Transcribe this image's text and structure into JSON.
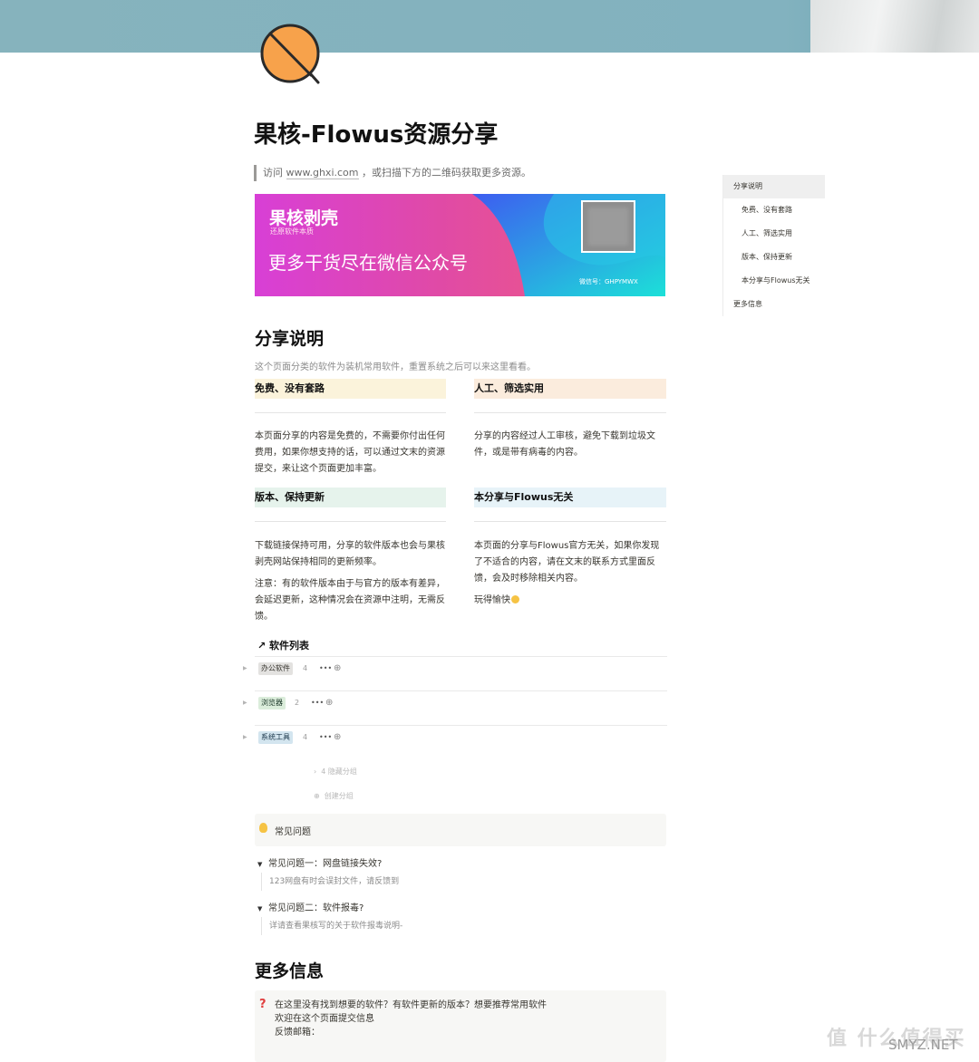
{
  "page": {
    "title": "果核-Flowus资源分享",
    "quote": {
      "prefix": "访问 ",
      "link": "www.ghxi.com",
      "suffix": " ，或扫描下方的二维码获取更多资源。"
    }
  },
  "banner": {
    "title": "果核剥壳",
    "subtitle": "还原软件本质",
    "slogan": "更多干货尽在微信公众号",
    "wechat_id": "微信号：GHPYMWX"
  },
  "toc": {
    "items": [
      {
        "label": "分享说明",
        "active": true
      },
      {
        "label": "免费、没有套路"
      },
      {
        "label": "人工、筛选实用"
      },
      {
        "label": "版本、保持更新"
      },
      {
        "label": "本分享与Flowus无关"
      },
      {
        "label": "更多信息"
      }
    ]
  },
  "share": {
    "heading": "分享说明",
    "intro": "这个页面分类的软件为装机常用软件，重置系统之后可以来这里看看。",
    "cards": [
      {
        "title": "免费、没有套路",
        "color": "#fbf3db",
        "paras": [
          "本页面分享的内容是免费的，不需要你付出任何费用，如果你想支持的话，可以通过文末的资源提交，来让这个页面更加丰富。"
        ]
      },
      {
        "title": "人工、筛选实用",
        "color": "#fbecdd",
        "paras": [
          "分享的内容经过人工审核，避免下载到垃圾文件，或是带有病毒的内容。"
        ]
      },
      {
        "title": "版本、保持更新",
        "color": "#e6f3ec",
        "paras": [
          "下载链接保持可用，分享的软件版本也会与果核剥壳网站保持相同的更新频率。",
          "注意：有的软件版本由于与官方的版本有差异，会延迟更新，这种情况会在资源中注明，无需反馈。"
        ]
      },
      {
        "title": "本分享与Flowus无关",
        "color": "#e7f3f8",
        "paras": [
          "本页面的分享与Flowus官方无关，如果你发现了不适合的内容，请在文末的联系方式里面反馈，会及时移除相关内容。",
          "玩得愉快"
        ]
      }
    ]
  },
  "software": {
    "title": "软件列表",
    "groups": [
      {
        "name": "办公软件",
        "count": "4",
        "bg": "#e3e2e0",
        "fg": "#37352f"
      },
      {
        "name": "浏览器",
        "count": "2",
        "bg": "#dbeddb",
        "fg": "#1c3829"
      },
      {
        "name": "系统工具",
        "count": "4",
        "bg": "#d3e5ef",
        "fg": "#183347"
      }
    ],
    "more_label": "•••",
    "add_label": "⊕",
    "hidden_groups": "4 隐藏分组",
    "create_group": "创建分组"
  },
  "faq": {
    "callout": "常见问题",
    "items": [
      {
        "q": "常见问题一：网盘链接失效?",
        "a": "123网盘有时会误封文件，请反馈到"
      },
      {
        "q": "常见问题二：软件报毒?",
        "a": "详请查看果核写的关于软件报毒说明-"
      }
    ]
  },
  "more": {
    "heading": "更多信息",
    "lines": [
      "在这里没有找到想要的软件？有软件更新的版本？想要推荐常用软件",
      "欢迎在这个页面提交信息",
      "反馈邮箱："
    ]
  },
  "watermark": {
    "text": "值 什么值得买",
    "brand": "SMYZ.NET"
  },
  "colors": {
    "cover": "#86b3bd",
    "icon_fill": "#f7a24b",
    "accent": "#111111"
  }
}
